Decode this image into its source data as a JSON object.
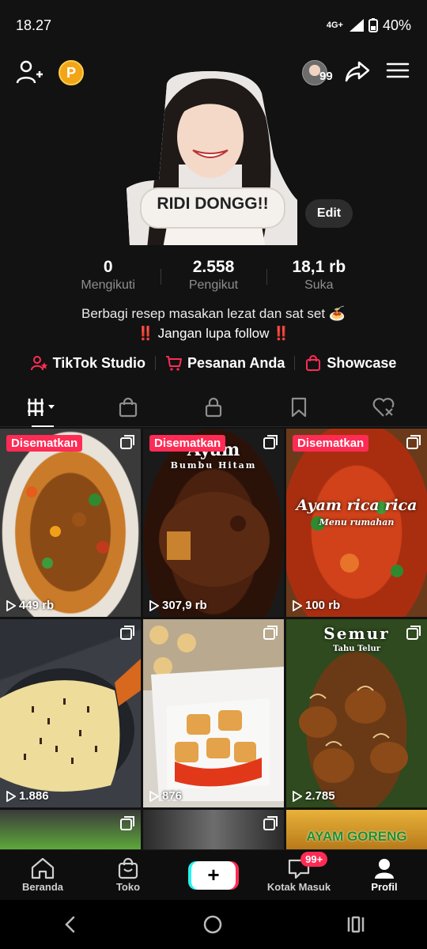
{
  "status_bar": {
    "time": "18.27",
    "network": "4G+",
    "battery": "40%"
  },
  "top_bar": {
    "friends_badge": "99",
    "coin_label": "P"
  },
  "profile": {
    "sticker_text": "RIDI DONGG!!",
    "edit_label": "Edit"
  },
  "stats": [
    {
      "value": "0",
      "label": "Mengikuti"
    },
    {
      "value": "2.558",
      "label": "Pengikut"
    },
    {
      "value": "18,1 rb",
      "label": "Suka"
    }
  ],
  "bio": {
    "line1": "Berbagi resep masakan lezat dan sat set 🍝",
    "line2": "‼️ Jangan lupa follow ‼️"
  },
  "links": {
    "studio": "TikTok Studio",
    "orders": "Pesanan Anda",
    "showcase": "Showcase"
  },
  "videos": [
    {
      "pinned": "Disematkan",
      "views": "449 rb"
    },
    {
      "pinned": "Disematkan",
      "views": "307,9 rb",
      "title": "Ayam",
      "subtitle": "Bumbu Hitam"
    },
    {
      "pinned": "Disematkan",
      "views": "100 rb",
      "title": "Ayam rica rica",
      "subtitle": "Menu rumahan"
    },
    {
      "views": "1.886"
    },
    {
      "views": "876"
    },
    {
      "views": "2.785",
      "title": "Semur",
      "subtitle": "Tahu Telur"
    },
    {},
    {},
    {
      "title": "AYAM GORENG"
    }
  ],
  "bottom_nav": {
    "home": "Beranda",
    "shop": "Toko",
    "plus": "+",
    "inbox": "Kotak Masuk",
    "inbox_badge": "99+",
    "profile": "Profil"
  },
  "colors": {
    "accent": "#fe2c55",
    "cyan": "#25f4ee",
    "background": "#121212"
  }
}
